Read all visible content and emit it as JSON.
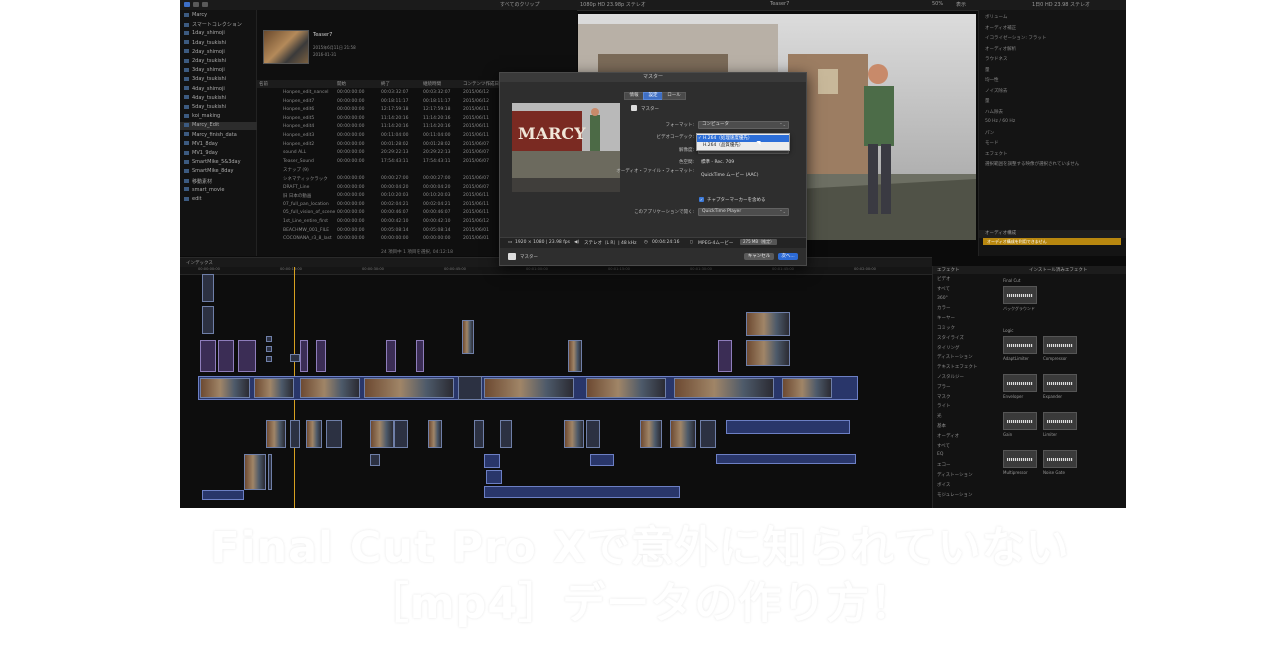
{
  "toolbar": {
    "browser_filter": "すべてのクリップ",
    "viewer_format": "1080p HD 23.98p ステレオ",
    "project_name": "Teaser7",
    "zoom": "50%",
    "view_menu": "表示",
    "inspector_timecode": "1日0 HD 23.98 ステレオ"
  },
  "library": {
    "items": [
      "Marcy",
      "スマートコレクション",
      "1day_shimoji",
      "1day_tsukishi",
      "2day_shimoji",
      "2day_tsukishi",
      "3day_shimoji",
      "3day_tsukishi",
      "4day_shimoji",
      "4day_tsukishi",
      "5day_tsukishi",
      "koi_making",
      "Marcy_Edit",
      "Marcy_finish_data",
      "MV1_8day",
      "MV1_9day",
      "SmartMike_5&3day",
      "SmartMike_8day",
      "移動素材",
      "smart_movie",
      "edit"
    ],
    "selected_index": 12
  },
  "browser": {
    "clip_title": "Teaser7",
    "clip_meta1": "2015年6月11日 21:58",
    "clip_meta2": "2016-01-31",
    "columns": [
      "名前",
      "開始",
      "終了",
      "継続時間",
      "コンテンツ作成日"
    ],
    "rows": [
      [
        "Honpen_edit_nancel",
        "00:00:00:00",
        "00:03:32:07",
        "00:03:32:07",
        "2015/06/12"
      ],
      [
        "Honpen_edit7",
        "00:00:00:00",
        "00:18:11:17",
        "00:18:11:17",
        "2015/06/12"
      ],
      [
        "Honpen_edit6",
        "00:00:00:00",
        "12:17:59:18",
        "12:17:59:18",
        "2015/06/11"
      ],
      [
        "Honpen_edit5",
        "00:00:00:00",
        "11:14:20:16",
        "11:14:20:16",
        "2015/06/11"
      ],
      [
        "Honpen_edit4",
        "00:00:00:00",
        "11:14:20:16",
        "11:14:20:16",
        "2015/06/11"
      ],
      [
        "Honpen_edit3",
        "00:00:00:00",
        "00:11:04:00",
        "00:11:04:00",
        "2015/06/11"
      ],
      [
        "Honpen_edit2",
        "00:00:00:00",
        "00:01:28:02",
        "00:01:28:02",
        "2015/06/07"
      ],
      [
        "sound ALL",
        "00:00:00:00",
        "20:29:22:13",
        "20:29:22:13",
        "2015/06/07"
      ],
      [
        "Teaser_Sound",
        "00:00:00:00",
        "17:54:43:11",
        "17:54:43:11",
        "2015/06/07"
      ],
      [
        "スナップ (9)",
        "",
        "",
        "",
        ""
      ],
      [
        "シネマティックラック",
        "00:00:00:00",
        "00:00:27:00",
        "00:00:27:00",
        "2015/06/07"
      ],
      [
        "DRAFT_Line",
        "00:00:00:00",
        "00:00:04:20",
        "00:00:04:20",
        "2015/06/07"
      ],
      [
        "旧 日本の動画",
        "00:00:00:00",
        "00:10:20:03",
        "00:10:20:03",
        "2015/06/11"
      ],
      [
        "07_full_pan_location",
        "00:00:00:00",
        "00:02:04:21",
        "00:02:04:21",
        "2015/06/11"
      ],
      [
        "05_full_vision_of_scene",
        "00:00:00:00",
        "00:00:46:07",
        "00:00:46:07",
        "2015/06/11"
      ],
      [
        "1st_Line_entire_first",
        "00:00:00:00",
        "00:00:42:10",
        "00:00:42:10",
        "2015/06/12"
      ],
      [
        "BEACHMW_001_FILE",
        "00:00:00:00",
        "00:05:08:14",
        "00:05:08:14",
        "2015/06/01"
      ],
      [
        "COCONANA_r3_8_last",
        "00:00:00:00",
        "00:00:00:00",
        "00:00:00:00",
        "2015/06/01"
      ]
    ],
    "status": "24 項目中 1 項目を選択, 04:12:18"
  },
  "inspector": {
    "rows": [
      "ボリューム",
      "オーディオ補正",
      "イコライゼーション: フラット",
      "オーディオ解析",
      "ラウドネス",
      "量",
      "均一性",
      "ノイズ除去",
      "量",
      "ハム除去",
      "50 Hz / 60 Hz",
      "パン",
      "モード",
      "エフェクト",
      "選択範囲を調整する映像が選択されていません"
    ],
    "footer_label": "オーディオ構成",
    "footer_warning": "オーディオ構成を利用できません"
  },
  "timeline": {
    "index_label": "インデックス",
    "ruler": [
      "00:00:00:00",
      "00:00:15:00",
      "00:00:30:00",
      "00:00:45:00",
      "00:01:00:00",
      "00:01:15:00",
      "00:01:30:00",
      "00:01:45:00",
      "00:02:00:00"
    ]
  },
  "effects": {
    "header_left": "エフェクト",
    "header_right": "インストール済みエフェクト",
    "categories": [
      "ビデオ",
      "すべて",
      "360°",
      "カラー",
      "キーヤー",
      "コミック",
      "スタイライズ",
      "タイリング",
      "ディストーション",
      "テキストエフェクト",
      "ノスタルジー",
      "ブラー",
      "マスク",
      "ライト",
      "光",
      "基本",
      "オーディオ",
      "すべて",
      "EQ",
      "エコー",
      "ディストーション",
      "ボイス",
      "モジュレーション"
    ],
    "groups": [
      {
        "title": "Final Cut",
        "tiles": [
          "バックグラウンド"
        ]
      },
      {
        "title": "Logic",
        "tiles": [
          "AdaptLimiter",
          "Compressor",
          "Enveloper",
          "Expander",
          "Gain",
          "Limiter",
          "Multipressor",
          "Noise Gate"
        ]
      }
    ]
  },
  "dialog": {
    "title": "マスター",
    "tabs": [
      "情報",
      "設定",
      "ロール"
    ],
    "active_tab": 1,
    "preset_name": "マスター",
    "fields": {
      "format_label": "フォーマット:",
      "format_value": "コンピュータ",
      "codec_label": "ビデオコーデック:",
      "codec_options": [
        "H.264（処理速度優先）",
        "H.264（品質優先）"
      ],
      "codec_selected": 0,
      "resolution_label": "解像度:",
      "resolution_value": "1920 × 1080",
      "colorspace_label": "色空間:",
      "colorspace_value": "標準 - Rec. 709",
      "audio_format_label": "オーディオ・ファイル・フォーマット:",
      "audio_format_value": "QuickTime ムービー (AAC)",
      "chapter_label": "チャプターマーカーを含める",
      "chapter_checked": true,
      "open_with_label": "このアプリケーションで開く:",
      "open_with_value": "QuickTime Player"
    },
    "summary": {
      "video": "1920 × 1080 | 23.98 fps",
      "audio": "ステレオ（L R）| 48 kHz",
      "duration": "00:04:24:16",
      "file_type": "MPEG-4ムービー",
      "size": "275 MB（推定）"
    },
    "footer": {
      "destination": "マスター",
      "cancel": "キャンセル",
      "next": "次へ..."
    },
    "preview_title_text": "MARCY"
  },
  "caption": {
    "line1": "Final Cut Pro Xで意外に知られていない",
    "line2": "［mp4］データの作り方！"
  }
}
